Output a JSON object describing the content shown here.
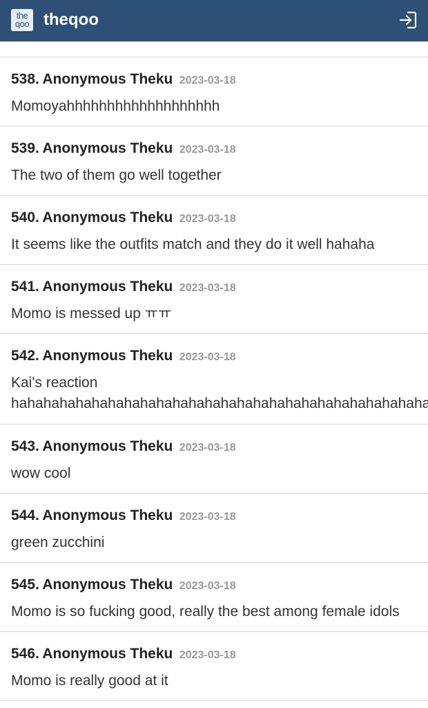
{
  "header": {
    "logo_top": "the",
    "logo_bottom": "qoo",
    "site_title": "theqoo",
    "login_icon": "login-icon",
    "background": "#2e5077"
  },
  "comments": [
    {
      "number": "538.",
      "author": "Anonymous Theku",
      "date": "2023-03-18",
      "text": "Momoyahhhhhhhhhhhhhhhhhhh"
    },
    {
      "number": "539.",
      "author": "Anonymous Theku",
      "date": "2023-03-18",
      "text": "The two of them go well together"
    },
    {
      "number": "540.",
      "author": "Anonymous Theku",
      "date": "2023-03-18",
      "text": "It seems like the outfits match and they do it well hahaha"
    },
    {
      "number": "541.",
      "author": "Anonymous Theku",
      "date": "2023-03-18",
      "text": "Momo is messed up ㅠㅠ"
    },
    {
      "number": "542.",
      "author": "Anonymous Theku",
      "date": "2023-03-18",
      "text": "Kai's reaction\nhahahahahahahahahahahahahahahahahahahahahahahahahaha"
    },
    {
      "number": "543.",
      "author": "Anonymous Theku",
      "date": "2023-03-18",
      "text": "wow cool"
    },
    {
      "number": "544.",
      "author": "Anonymous Theku",
      "date": "2023-03-18",
      "text": "green zucchini"
    },
    {
      "number": "545.",
      "author": "Anonymous Theku",
      "date": "2023-03-18",
      "text": "Momo is so fucking good, really the best among female idols"
    },
    {
      "number": "546.",
      "author": "Anonymous Theku",
      "date": "2023-03-18",
      "text": "Momo is really good at it"
    }
  ]
}
